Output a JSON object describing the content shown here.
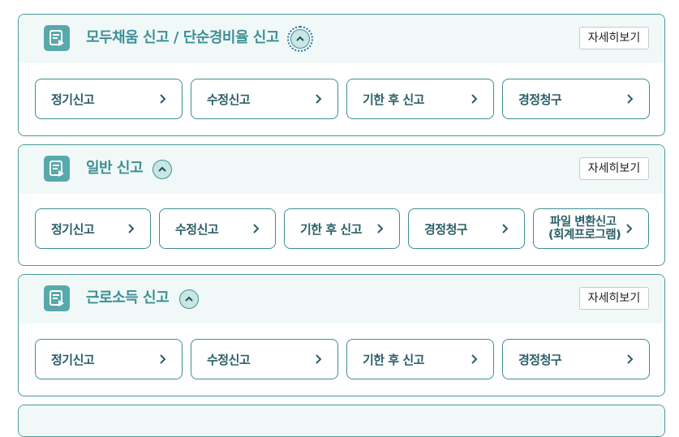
{
  "sections": [
    {
      "title": "모두채움 신고 / 단순경비율 신고",
      "detail_label": "자세히보기",
      "options": [
        "정기신고",
        "수정신고",
        "기한 후 신고",
        "경정청구"
      ]
    },
    {
      "title": "일반 신고",
      "detail_label": "자세히보기",
      "options": [
        "정기신고",
        "수정신고",
        "기한 후 신고",
        "경정청구"
      ],
      "extra_option": {
        "line1": "파일 변환신고",
        "line2": "(회계프로그램)"
      }
    },
    {
      "title": "근로소득 신고",
      "detail_label": "자세히보기",
      "options": [
        "정기신고",
        "수정신고",
        "기한 후 신고",
        "경정청구"
      ]
    }
  ],
  "colors": {
    "accent": "#3d8f96",
    "border": "#4a9a9a",
    "header_bg": "#f1f9f8",
    "toggle_bg": "#c7e6e4"
  },
  "icons": {
    "section": "document-edit-icon",
    "toggle": "chevron-up-icon",
    "option": "chevron-right-icon"
  }
}
